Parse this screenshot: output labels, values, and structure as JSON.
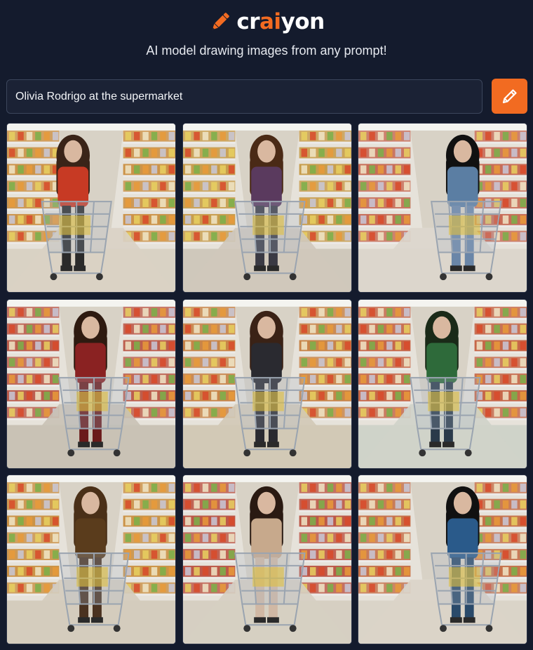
{
  "header": {
    "logo_prefix": "cr",
    "logo_accent": "ai",
    "logo_suffix": "yon",
    "logo_icon": "pencil-icon",
    "tagline": "AI model drawing images from any prompt!"
  },
  "prompt": {
    "value": "Olivia Rodrigo at the supermarket",
    "button_icon": "pencil-icon"
  },
  "colors": {
    "background": "#141b2d",
    "accent": "#f26b21",
    "input_bg": "#1b2235",
    "input_border": "#3c465c"
  },
  "results": {
    "rows": 3,
    "columns": 3,
    "images": [
      {
        "shelf": "#c98a3a",
        "floor": "#d9d2c4",
        "top": "#c73a24",
        "bottom": "#2a2a2a",
        "hair": "#3a2418",
        "pose": "left"
      },
      {
        "shelf": "#c4963f",
        "floor": "#cfc8bb",
        "top": "#5a3a5e",
        "bottom": "#3a3a44",
        "hair": "#4a2a16",
        "pose": "center"
      },
      {
        "shelf": "#c4604a",
        "floor": "#dcd6cc",
        "top": "#5b7ea3",
        "bottom": "#6a86a8",
        "hair": "#111111",
        "pose": "right"
      },
      {
        "shelf": "#b85040",
        "floor": "#c9c2b5",
        "top": "#8a2222",
        "bottom": "#6a1a1a",
        "hair": "#2e1a10",
        "pose": "center"
      },
      {
        "shelf": "#c47a3a",
        "floor": "#d2c9b6",
        "top": "#2a2a30",
        "bottom": "#2a2a30",
        "hair": "#3a2216",
        "pose": "center"
      },
      {
        "shelf": "#c25a3a",
        "floor": "#cfd3c9",
        "top": "#2e6a3a",
        "bottom": "#2a3a4a",
        "hair": "#1a2a18",
        "pose": "center"
      },
      {
        "shelf": "#c88a38",
        "floor": "#d4ccbd",
        "top": "#5a3c1c",
        "bottom": "#4a3220",
        "hair": "#4a3018",
        "pose": "center"
      },
      {
        "shelf": "#b84a3a",
        "floor": "#d6cfc2",
        "top": "#c7a98c",
        "bottom": "#d0b8a4",
        "hair": "#2a1a12",
        "pose": "center"
      },
      {
        "shelf": "#c2663e",
        "floor": "#dad4c8",
        "top": "#2a5a8a",
        "bottom": "#2a4a6a",
        "hair": "#111111",
        "pose": "right"
      }
    ]
  }
}
